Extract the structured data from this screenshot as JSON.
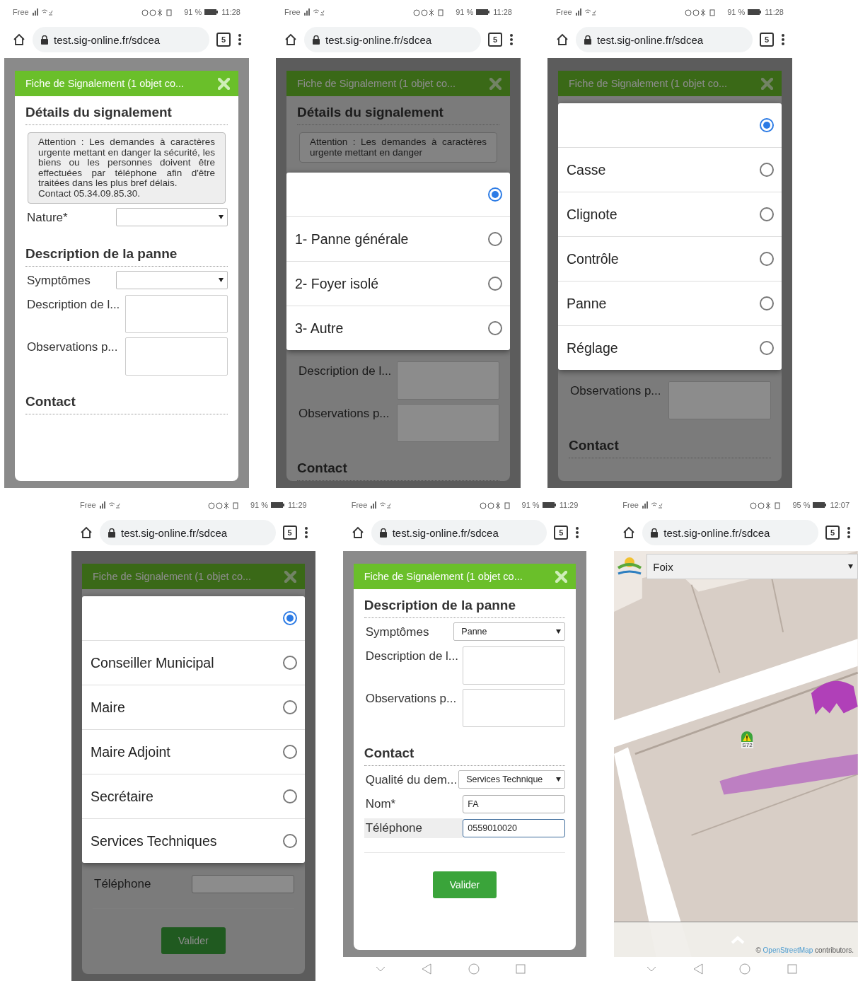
{
  "phones": [
    {
      "status": {
        "carrier": "Free",
        "battery": "91 %",
        "time": "11:28"
      },
      "url": "test.sig-online.fr/sdcea",
      "tab_count": "5",
      "nav_bar": false,
      "view": {
        "kind": "form",
        "dimmed": false,
        "title": "Fiche de Signalement (1 objet co...",
        "blocks": [
          {
            "kind": "heading",
            "text": "Détails du signalement"
          },
          {
            "kind": "notice",
            "lines": [
              "Attention : Les demandes à caractères urgente mettant en danger la sécurité, les biens ou les personnes doivent être effectuées par téléphone afin d'être traitées dans les plus bref délais.",
              "Contact 05.34.09.85.30."
            ]
          },
          {
            "kind": "select",
            "label": "Nature*"
          },
          {
            "kind": "heading",
            "text": "Description de la panne"
          },
          {
            "kind": "select",
            "label": "Symptômes"
          },
          {
            "kind": "textarea",
            "label": "Description de l..."
          },
          {
            "kind": "textarea",
            "label": "Observations p..."
          },
          {
            "kind": "heading",
            "text": "Contact"
          }
        ]
      }
    },
    {
      "status": {
        "carrier": "Free",
        "battery": "91 %",
        "time": "11:28"
      },
      "url": "test.sig-online.fr/sdcea",
      "tab_count": "5",
      "nav_bar": false,
      "view": {
        "kind": "form",
        "dimmed": true,
        "title": "Fiche de Signalement (1 objet co...",
        "blocks": [
          {
            "kind": "heading",
            "text": "Détails du signalement"
          },
          {
            "kind": "notice",
            "lines": [
              "Attention : Les demandes à caractères urgente mettant en danger"
            ]
          },
          {
            "kind": "popup",
            "options": [
              {
                "selected": true
              },
              {
                "label": "1- Panne générale",
                "selected": false
              },
              {
                "label": "2- Foyer isolé",
                "selected": false
              },
              {
                "label": "3- Autre",
                "selected": false
              }
            ]
          },
          {
            "kind": "textarea",
            "label": "Description de l..."
          },
          {
            "kind": "textarea",
            "label": "Observations p..."
          },
          {
            "kind": "heading",
            "text": "Contact"
          }
        ]
      }
    },
    {
      "status": {
        "carrier": "Free",
        "battery": "91 %",
        "time": "11:28"
      },
      "url": "test.sig-online.fr/sdcea",
      "tab_count": "5",
      "nav_bar": false,
      "view": {
        "kind": "form",
        "dimmed": true,
        "title": "Fiche de Signalement (1 objet co...",
        "blocks": [
          {
            "kind": "popup",
            "options": [
              {
                "selected": true
              },
              {
                "label": "Casse",
                "selected": false
              },
              {
                "label": "Clignote",
                "selected": false
              },
              {
                "label": "Contrôle",
                "selected": false
              },
              {
                "label": "Panne",
                "selected": false
              },
              {
                "label": "Réglage",
                "selected": false
              }
            ]
          },
          {
            "kind": "textarea",
            "label": "Observations p..."
          },
          {
            "kind": "heading",
            "text": "Contact"
          }
        ]
      }
    },
    {
      "status": {
        "carrier": "Free",
        "battery": "91 %",
        "time": "11:29"
      },
      "url": "test.sig-online.fr/sdcea",
      "tab_count": "5",
      "nav_bar": false,
      "view": {
        "kind": "form",
        "dimmed": true,
        "title": "Fiche de Signalement (1 objet co...",
        "blocks": [
          {
            "kind": "popup",
            "options": [
              {
                "selected": true
              },
              {
                "label": "Conseiller Municipal",
                "selected": false
              },
              {
                "label": "Maire",
                "selected": false
              },
              {
                "label": "Maire Adjoint",
                "selected": false
              },
              {
                "label": "Secrétaire",
                "selected": false
              },
              {
                "label": "Services Techniques",
                "selected": false
              }
            ]
          },
          {
            "kind": "input",
            "label": "Téléphone",
            "focused": false
          },
          {
            "kind": "button",
            "text": "Valider"
          }
        ]
      }
    },
    {
      "status": {
        "carrier": "Free",
        "battery": "91 %",
        "time": "11:29"
      },
      "url": "test.sig-online.fr/sdcea",
      "tab_count": "5",
      "nav_bar": true,
      "view": {
        "kind": "form",
        "dimmed": false,
        "title": "Fiche de Signalement (1 objet co...",
        "blocks": [
          {
            "kind": "heading",
            "text": "Description de la panne"
          },
          {
            "kind": "select",
            "label": "Symptômes",
            "value": "Panne"
          },
          {
            "kind": "textarea",
            "label": "Description de l..."
          },
          {
            "kind": "textarea",
            "label": "Observations p..."
          },
          {
            "kind": "heading",
            "text": "Contact"
          },
          {
            "kind": "select",
            "label": "Qualité du dem...",
            "value": "Services Technique"
          },
          {
            "kind": "input",
            "label": "Nom*",
            "value": "FA",
            "focused": false
          },
          {
            "kind": "input",
            "label": "Téléphone",
            "value": "0559010020",
            "focused": true
          },
          {
            "kind": "button",
            "text": "Valider"
          }
        ]
      }
    },
    {
      "status": {
        "carrier": "Free",
        "battery": "95 %",
        "time": "12:07"
      },
      "url": "test.sig-online.fr/sdcea",
      "tab_count": "5",
      "nav_bar": true,
      "view": {
        "kind": "map",
        "place": "Foix",
        "marker_label": "S72",
        "attribution": {
          "prefix": "©",
          "link": "OpenStreetMap",
          "suffix": "contributors."
        }
      }
    }
  ]
}
